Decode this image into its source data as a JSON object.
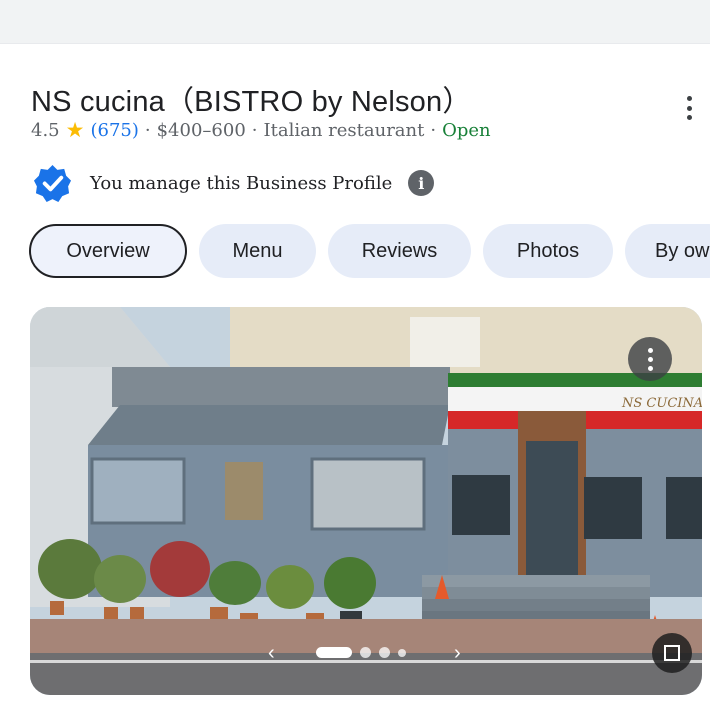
{
  "place": {
    "name": "NS cucina（BISTRO by Nelson）",
    "rating": "4.5",
    "review_count": "(675)",
    "price_range": "$400–600",
    "category": "Italian restaurant",
    "status": "Open",
    "separator": "·"
  },
  "profile": {
    "manage_label": "You manage this Business Profile",
    "info_glyph": "i"
  },
  "tabs": [
    {
      "label": "Overview",
      "active": true
    },
    {
      "label": "Menu",
      "active": false
    },
    {
      "label": "Reviews",
      "active": false
    },
    {
      "label": "Photos",
      "active": false
    },
    {
      "label": "By ow",
      "active": false
    }
  ],
  "photo": {
    "sign_text": "NS CUCINA",
    "carousel_count": 4,
    "carousel_index": 1,
    "prev_glyph": "‹",
    "next_glyph": "›"
  },
  "icons": {
    "star": "star-icon",
    "verified": "verified-badge-icon",
    "info": "info-icon",
    "more": "more-vert-icon",
    "expand": "expand-icon"
  },
  "colors": {
    "accent_blue": "#1a73e8",
    "open_green": "#188038",
    "star_yellow": "#fbbc04",
    "tab_bg": "#e6ecf8"
  }
}
